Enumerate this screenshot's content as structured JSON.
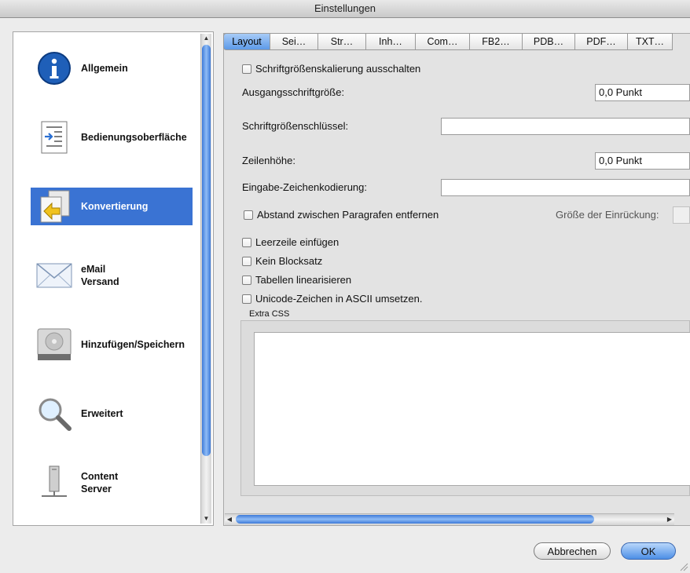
{
  "window": {
    "title": "Einstellungen"
  },
  "sidebar": {
    "items": [
      {
        "label": "Allgemein",
        "icon": "info-icon"
      },
      {
        "label": "Bedienungsoberfläche",
        "icon": "document-arrow-icon"
      },
      {
        "label": "Konvertierung",
        "icon": "convert-icon",
        "active": true
      },
      {
        "label": "eMail\nVersand",
        "icon": "envelope-icon"
      },
      {
        "label": "Hinzufügen/Speichern",
        "icon": "hard-drive-icon"
      },
      {
        "label": "Erweitert",
        "icon": "magnifier-icon"
      },
      {
        "label": "Content\nServer",
        "icon": "server-icon"
      }
    ]
  },
  "tabs": [
    {
      "label": "Layout",
      "active": true
    },
    {
      "label": "Sei…"
    },
    {
      "label": "Str…"
    },
    {
      "label": "Inh…"
    },
    {
      "label": "Com…"
    },
    {
      "label": "FB2…"
    },
    {
      "label": "PDB…"
    },
    {
      "label": "PDF…"
    },
    {
      "label": "TXT…"
    }
  ],
  "layout": {
    "disable_font_rescaling": "Schriftgrößenskalierung ausschalten",
    "base_font_size_label": "Ausgangsschriftgröße:",
    "base_font_size_value": "0,0 Punkt",
    "font_key_label": "Schriftgrößenschlüssel:",
    "font_key_value": "",
    "line_height_label": "Zeilenhöhe:",
    "line_height_value": "0,0 Punkt",
    "input_encoding_label": "Eingabe-Zeichenkodierung:",
    "input_encoding_value": "",
    "remove_paragraph_spacing": "Abstand zwischen Paragrafen entfernen",
    "indent_size_label": "Größe der Einrückung:",
    "insert_blank_line": "Leerzeile einfügen",
    "no_justification": "Kein Blocksatz",
    "linearize_tables": "Tabellen linearisieren",
    "unicode_to_ascii": "Unicode-Zeichen in ASCII umsetzen.",
    "extra_css_label": "Extra CSS",
    "extra_css_value": ""
  },
  "buttons": {
    "cancel": "Abbrechen",
    "ok": "OK"
  },
  "colors": {
    "selection": "#3a73d3",
    "scroll_thumb": "#5b95e6"
  }
}
